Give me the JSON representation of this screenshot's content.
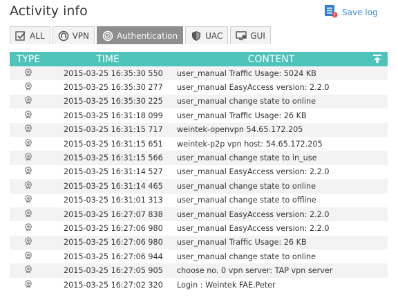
{
  "header": {
    "title": "Activity info",
    "save_label": "Save log"
  },
  "tabs": [
    {
      "label": "ALL",
      "icon": "list-check-icon",
      "active": false
    },
    {
      "label": "VPN",
      "icon": "vpn-icon",
      "active": false
    },
    {
      "label": "Authentication",
      "icon": "badge-check-icon",
      "active": true
    },
    {
      "label": "UAC",
      "icon": "shield-icon",
      "active": false
    },
    {
      "label": "GUI",
      "icon": "monitor-icon",
      "active": false
    }
  ],
  "table": {
    "columns": [
      "TYPE",
      "TIME",
      "CONTENT"
    ],
    "rows": [
      {
        "time": "2015-03-25 16:35:30 550",
        "content": "user_manual Traffic Usage: 5024 KB"
      },
      {
        "time": "2015-03-25 16:35:30 277",
        "content": "user_manual EasyAccess version: 2.2.0"
      },
      {
        "time": "2015-03-25 16:35:30 225",
        "content": "user_manual change state to online"
      },
      {
        "time": "2015-03-25 16:31:18 099",
        "content": "user_manual Traffic Usage: 26 KB"
      },
      {
        "time": "2015-03-25 16:31:15 717",
        "content": "weintek-openvpn 54.65.172.205"
      },
      {
        "time": "2015-03-25 16:31:15 651",
        "content": "weintek-p2p vpn host: 54.65.172.205"
      },
      {
        "time": "2015-03-25 16:31:15 566",
        "content": "user_manual change state to in_use"
      },
      {
        "time": "2015-03-25 16:31:14 527",
        "content": "user_manual EasyAccess version: 2.2.0"
      },
      {
        "time": "2015-03-25 16:31:14 465",
        "content": "user_manual change state to online"
      },
      {
        "time": "2015-03-25 16:31:01 313",
        "content": "user_manual change state to offline"
      },
      {
        "time": "2015-03-25 16:27:07 838",
        "content": "user_manual EasyAccess version: 2.2.0"
      },
      {
        "time": "2015-03-25 16:27:06 980",
        "content": "user_manual EasyAccess version: 2.2.0"
      },
      {
        "time": "2015-03-25 16:27:06 980",
        "content": "user_manual Traffic Usage: 26 KB"
      },
      {
        "time": "2015-03-25 16:27:06 944",
        "content": "user_manual change state to online"
      },
      {
        "time": "2015-03-25 16:27:05 905",
        "content": "choose no. 0 vpn server: TAP vpn server"
      },
      {
        "time": "2015-03-25 16:27:02 320",
        "content": "Login : Weintek  FAE.Peter"
      }
    ]
  },
  "colors": {
    "header_bg": "#4ec3b9",
    "active_tab": "#8e8e8e",
    "link": "#3a8fd6",
    "row_alt": "#f3f3f3"
  }
}
